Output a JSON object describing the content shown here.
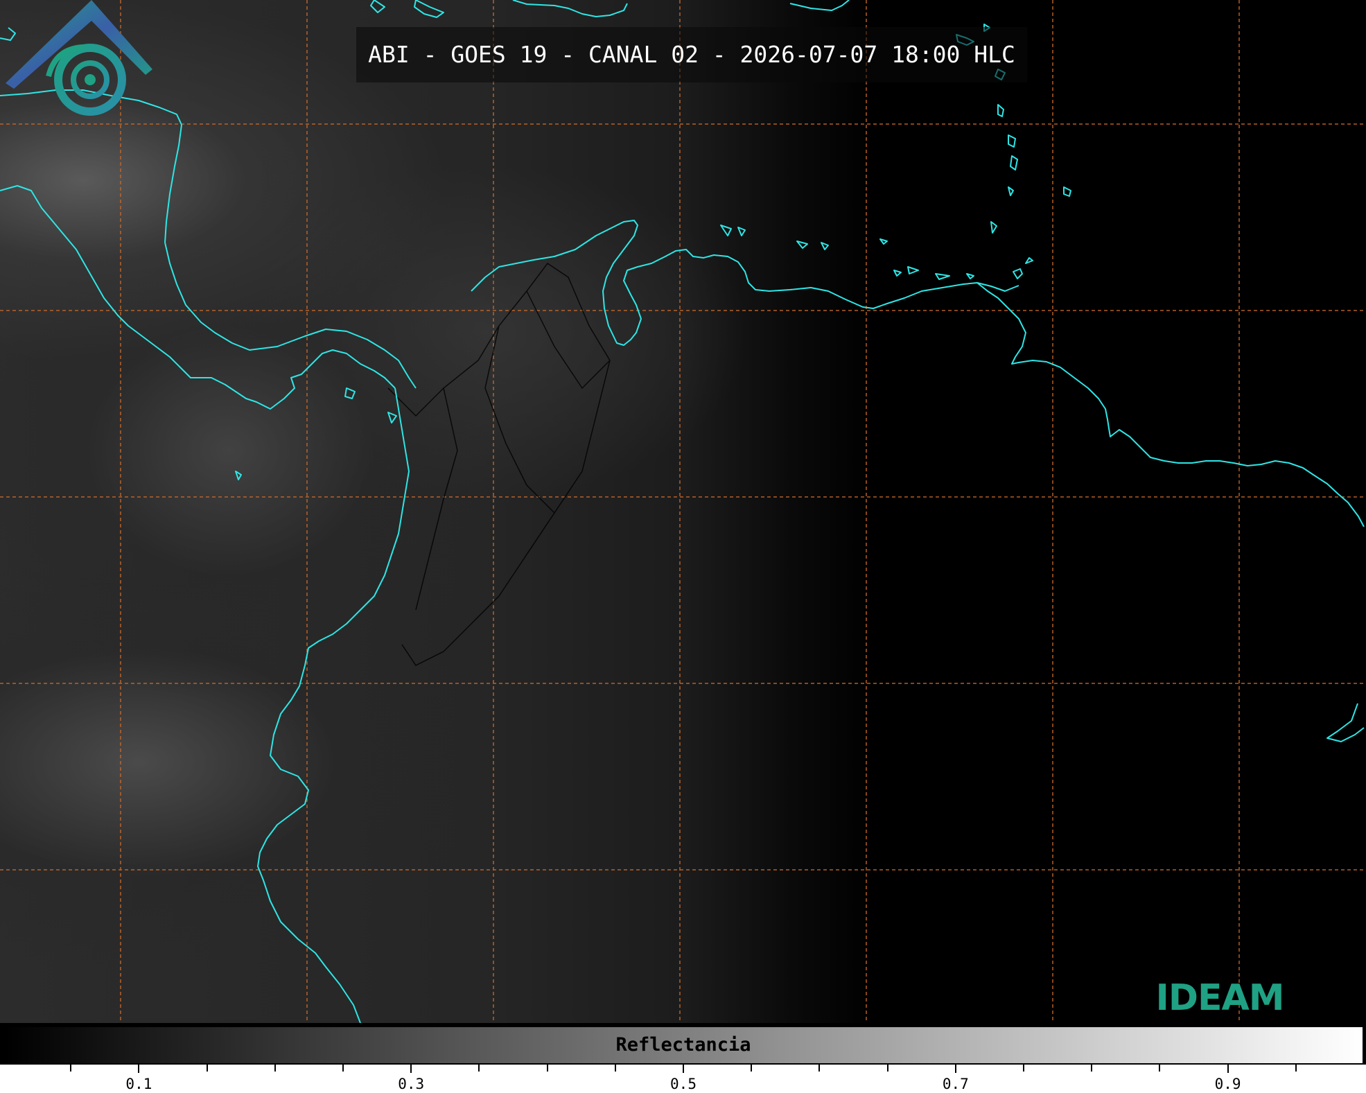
{
  "title": "ABI - GOES 19 - CANAL 02 - 2026-07-07 18:00 HLC",
  "logo_text": "IDEAM",
  "colorbar": {
    "label": "Reflectancia",
    "range": [
      0.0,
      1.0
    ],
    "colors": [
      "#000000",
      "#ffffff"
    ],
    "major_ticks": [
      {
        "value": 0.1,
        "label": "0.1"
      },
      {
        "value": 0.3,
        "label": "0.3"
      },
      {
        "value": 0.5,
        "label": "0.5"
      },
      {
        "value": 0.7,
        "label": "0.7"
      },
      {
        "value": 0.9,
        "label": "0.9"
      }
    ],
    "minor_tick_step": 0.05
  },
  "colors": {
    "coastline": "#2ee6e6",
    "gridline": "#c8682a",
    "borders": "#000000",
    "logo_blue": "#3a5fa8",
    "logo_teal": "#1fa184"
  }
}
